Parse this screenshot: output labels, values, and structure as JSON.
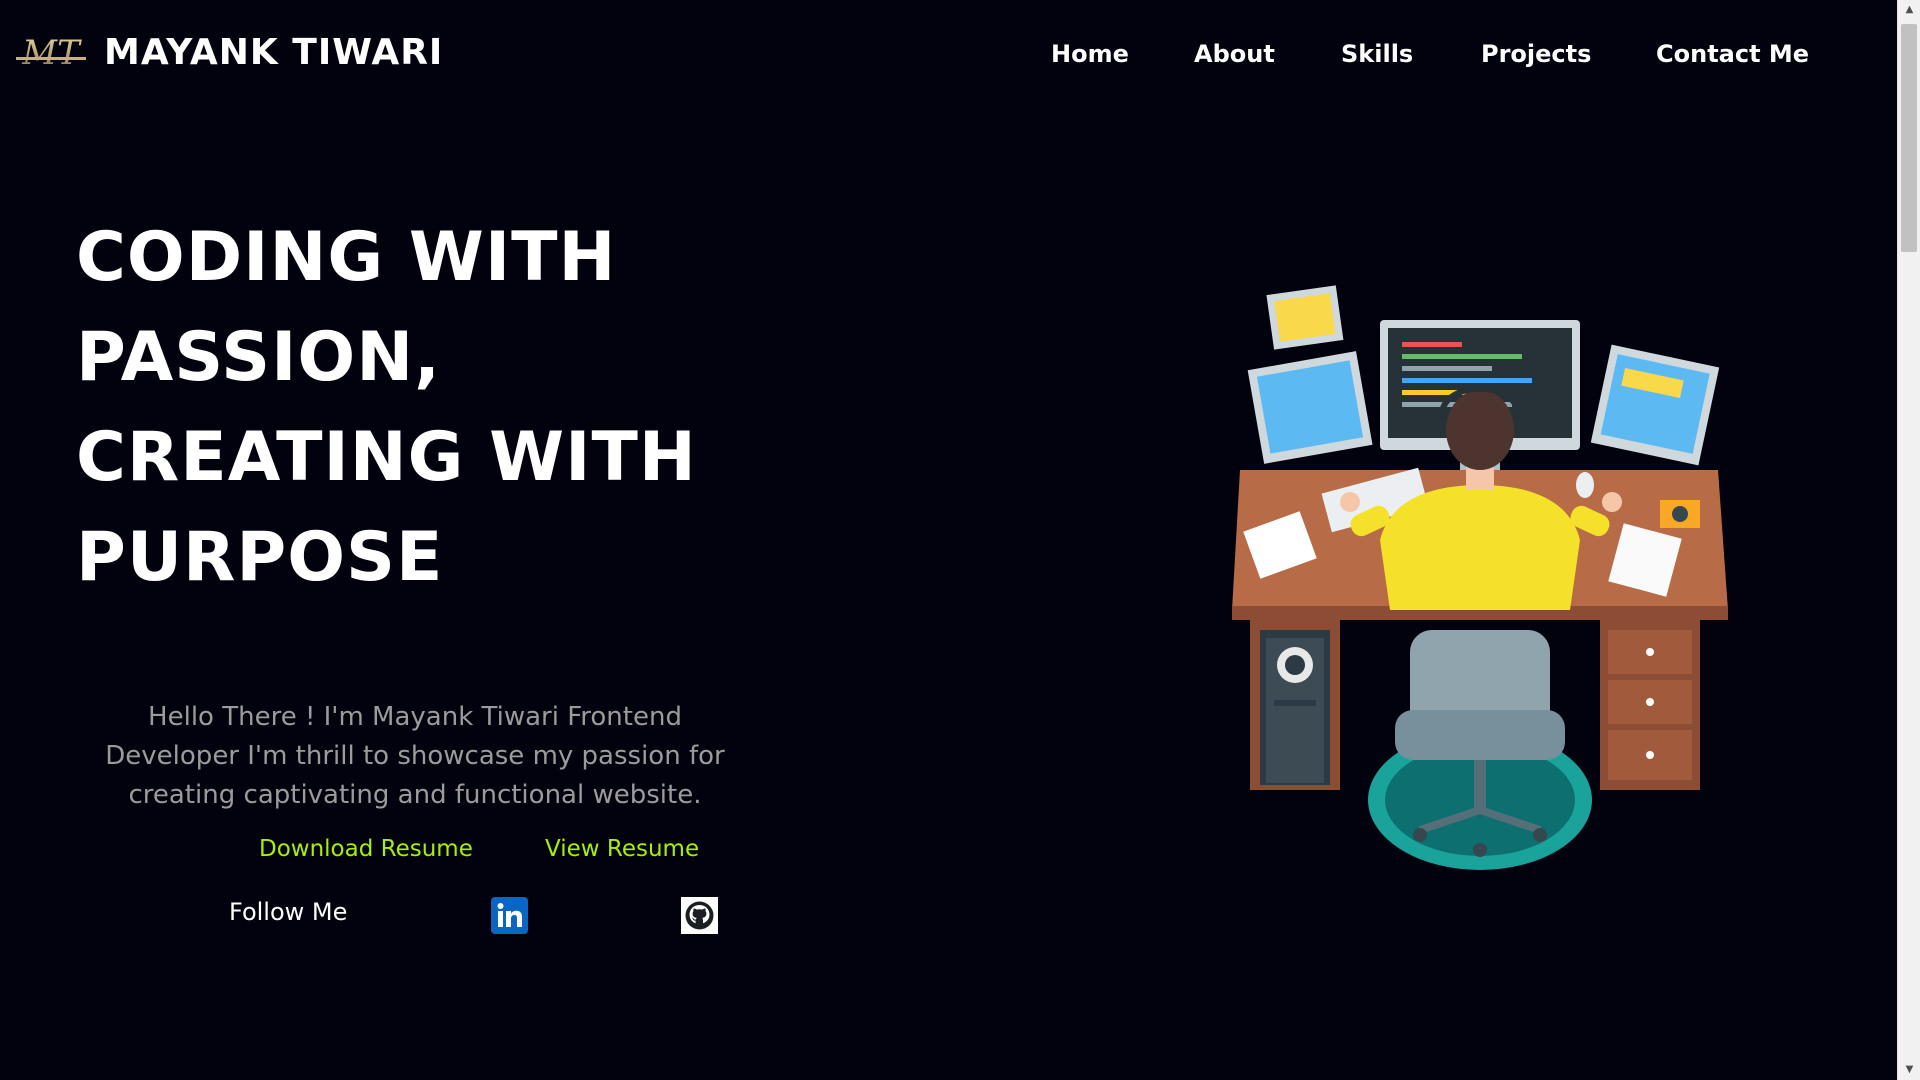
{
  "header": {
    "logo_text": "MT",
    "brand_name": "MAYANK TIWARI",
    "nav": [
      "Home",
      "About",
      "Skills",
      "Projects",
      "Contact Me"
    ]
  },
  "hero": {
    "title_lines": [
      "CODING WITH",
      "PASSION,",
      "CREATING WITH",
      "PURPOSE"
    ],
    "intro": "Hello There ! I'm Mayank Tiwari Frontend Developer I'm thrill to showcase my passion for creating captivating and functional website.",
    "download_resume": "Download Resume",
    "view_resume": "View Resume",
    "follow_label": "Follow Me"
  },
  "social": {
    "linkedin": "linkedin-icon",
    "github": "github-icon"
  },
  "colors": {
    "background": "#02020f",
    "accent": "#a6f000",
    "muted_text": "#9b9b9b",
    "linkedin_blue": "#0a66c2"
  }
}
